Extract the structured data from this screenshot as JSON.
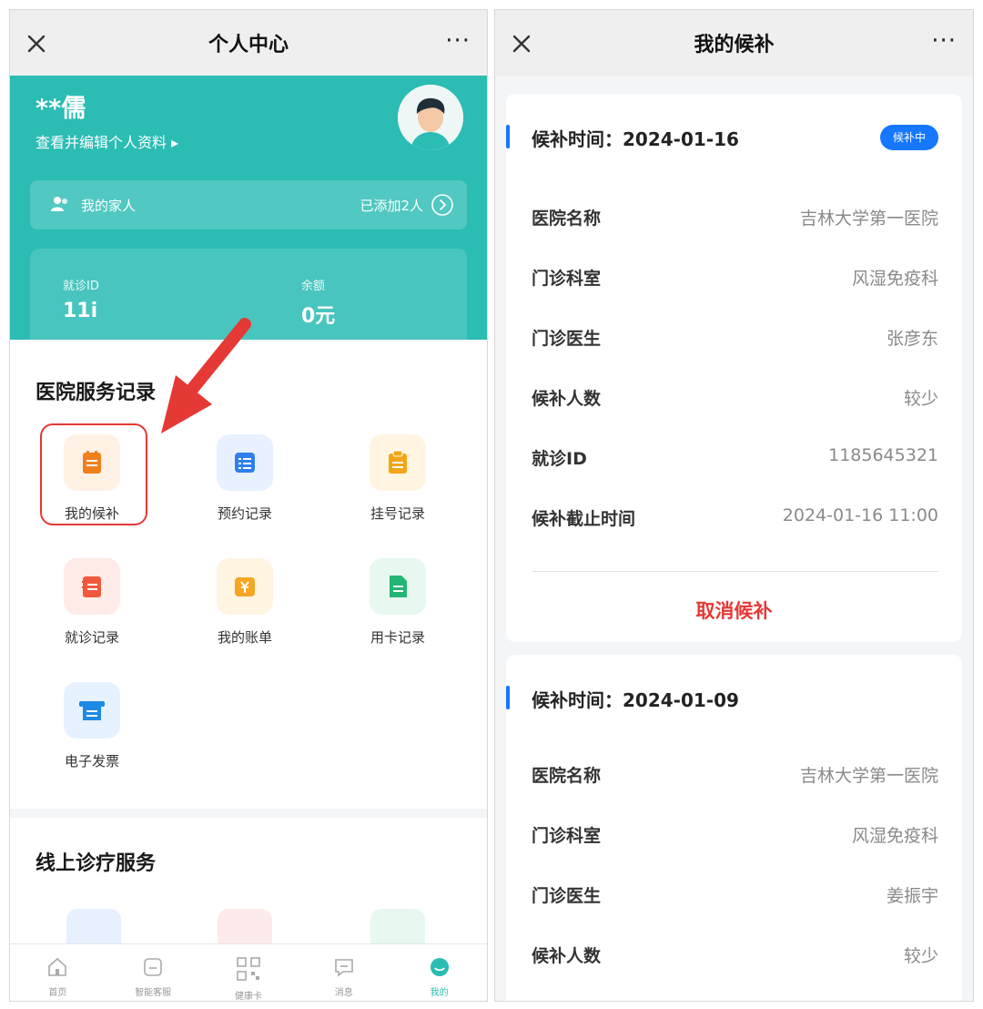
{
  "left": {
    "titlebar": {
      "title": "个人中心",
      "more": "···"
    },
    "profile": {
      "name": "**儒",
      "edit_link": "查看并编辑个人资料 ▸",
      "family_label": "我的家人",
      "family_count": "已添加2人",
      "visit_id_label": "就诊ID",
      "visit_id_value": "11i",
      "balance_label": "余额",
      "balance_value": "0元"
    },
    "hospital_section": {
      "title": "医院服务记录",
      "items": [
        {
          "label": "我的候补",
          "icon": "waitlist-icon",
          "color": "#f07f1e",
          "bg": "#fff1e4"
        },
        {
          "label": "预约记录",
          "icon": "appointment-icon",
          "color": "#2f80ed",
          "bg": "#e8f1ff"
        },
        {
          "label": "挂号记录",
          "icon": "registration-icon",
          "color": "#f2a516",
          "bg": "#fff5e0"
        },
        {
          "label": "就诊记录",
          "icon": "visit-record-icon",
          "color": "#ef5a3c",
          "bg": "#ffece8"
        },
        {
          "label": "我的账单",
          "icon": "bill-icon",
          "color": "#f5a623",
          "bg": "#fff5e0"
        },
        {
          "label": "用卡记录",
          "icon": "card-record-icon",
          "color": "#22b573",
          "bg": "#e6f8ef"
        },
        {
          "label": "电子发票",
          "icon": "invoice-icon",
          "color": "#1e88e5",
          "bg": "#e6f2ff"
        }
      ]
    },
    "online_section": {
      "title": "线上诊疗服务"
    },
    "tabbar": [
      {
        "label": "首页",
        "icon": "home-icon"
      },
      {
        "label": "智能客服",
        "icon": "chat-service-icon"
      },
      {
        "label": "健康卡",
        "icon": "qr-code-icon"
      },
      {
        "label": "消息",
        "icon": "message-icon"
      },
      {
        "label": "我的",
        "icon": "profile-icon"
      }
    ]
  },
  "right": {
    "titlebar": {
      "title": "我的候补",
      "more": "···"
    },
    "waitlist_label": "候补时间：",
    "cards": [
      {
        "date": "2024-01-16",
        "status": "候补中",
        "rows": [
          {
            "key": "医院名称",
            "value": "吉林大学第一医院"
          },
          {
            "key": "门诊科室",
            "value": "风湿免疫科"
          },
          {
            "key": "门诊医生",
            "value": "张彦东"
          },
          {
            "key": "候补人数",
            "value": "较少"
          },
          {
            "key": "就诊ID",
            "value": "1185645321"
          },
          {
            "key": "候补截止时间",
            "value": "2024-01-16 11:00"
          }
        ],
        "action": "取消候补"
      },
      {
        "date": "2024-01-09",
        "rows": [
          {
            "key": "医院名称",
            "value": "吉林大学第一医院"
          },
          {
            "key": "门诊科室",
            "value": "风湿免疫科"
          },
          {
            "key": "门诊医生",
            "value": "姜振宇"
          },
          {
            "key": "候补人数",
            "value": "较少"
          }
        ]
      }
    ]
  }
}
